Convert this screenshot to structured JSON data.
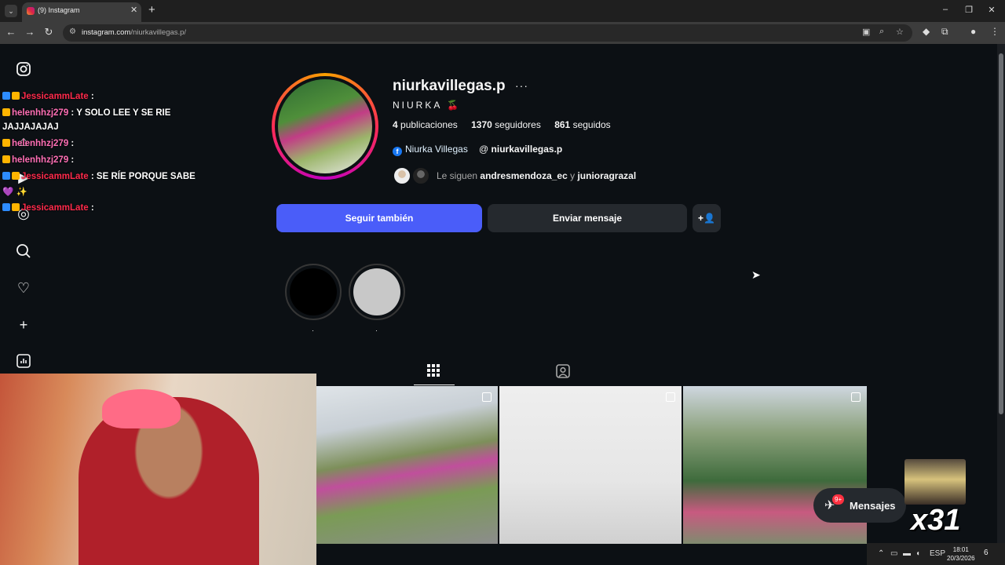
{
  "browser": {
    "tab_title": "(9) Instagram",
    "url_domain": "instagram.com",
    "url_path": "/niurkavillegas.p/",
    "new_tab": "+",
    "close_tab": "✕"
  },
  "profile": {
    "username": "niurkavillegas.p",
    "more": "···",
    "full_name": "NIURKA 🍒",
    "posts_count": "4",
    "posts_label": "publicaciones",
    "followers_count": "1370",
    "followers_label": "seguidores",
    "following_count": "861",
    "following_label": "seguidos",
    "facebook_link": "Niurka Villegas",
    "threads_link": "niurkavillegas.p",
    "followed_by_prefix": "Le siguen",
    "followed_by_user1": "andresmendoza_ec",
    "followed_by_and": "y",
    "followed_by_user2": "junioragrazal",
    "follow_button": "Seguir también",
    "message_button": "Enviar mensaje",
    "add_user_icon": "+👤",
    "story1_label": "·",
    "story2_label": "·"
  },
  "chat": [
    {
      "name": "JessicammLate",
      "sep": ":",
      "text": ""
    },
    {
      "name": "helenhhzj279",
      "sep": ":",
      "text": "Y SOLO LEE Y SE RIE"
    },
    {
      "name": "",
      "sep": "",
      "text": "JAJJAJAJAJ"
    },
    {
      "name": "helenhhzj279",
      "sep": ":",
      "text": ""
    },
    {
      "name": "helenhhzj279",
      "sep": ":",
      "text": ""
    },
    {
      "name": "JessicammLate",
      "sep": ":",
      "text": "SE RÍE PORQUE SABE"
    },
    {
      "name": "",
      "sep": "",
      "text": "💜 ✨"
    },
    {
      "name": "JessicammLate",
      "sep": ":",
      "text": ""
    }
  ],
  "messages_widget": {
    "label": "Mensajes",
    "badge": "9+"
  },
  "overlay": {
    "multiplier": "x31"
  },
  "taskbar": {
    "language": "ESP",
    "time": "18:01",
    "date": "20/3/2026",
    "notifications": "6"
  },
  "colors": {
    "background": "#0c1014",
    "follow_button": "#4a5df9",
    "secondary_button": "#25292e",
    "chat_name": "#ff2a4b"
  },
  "icons": [
    "instagram-logo-icon",
    "home-icon",
    "reels-icon",
    "explore-icon",
    "search-icon",
    "heart-icon",
    "create-icon",
    "dashboard-icon",
    "grid-icon",
    "tagged-icon",
    "messenger-icon"
  ]
}
